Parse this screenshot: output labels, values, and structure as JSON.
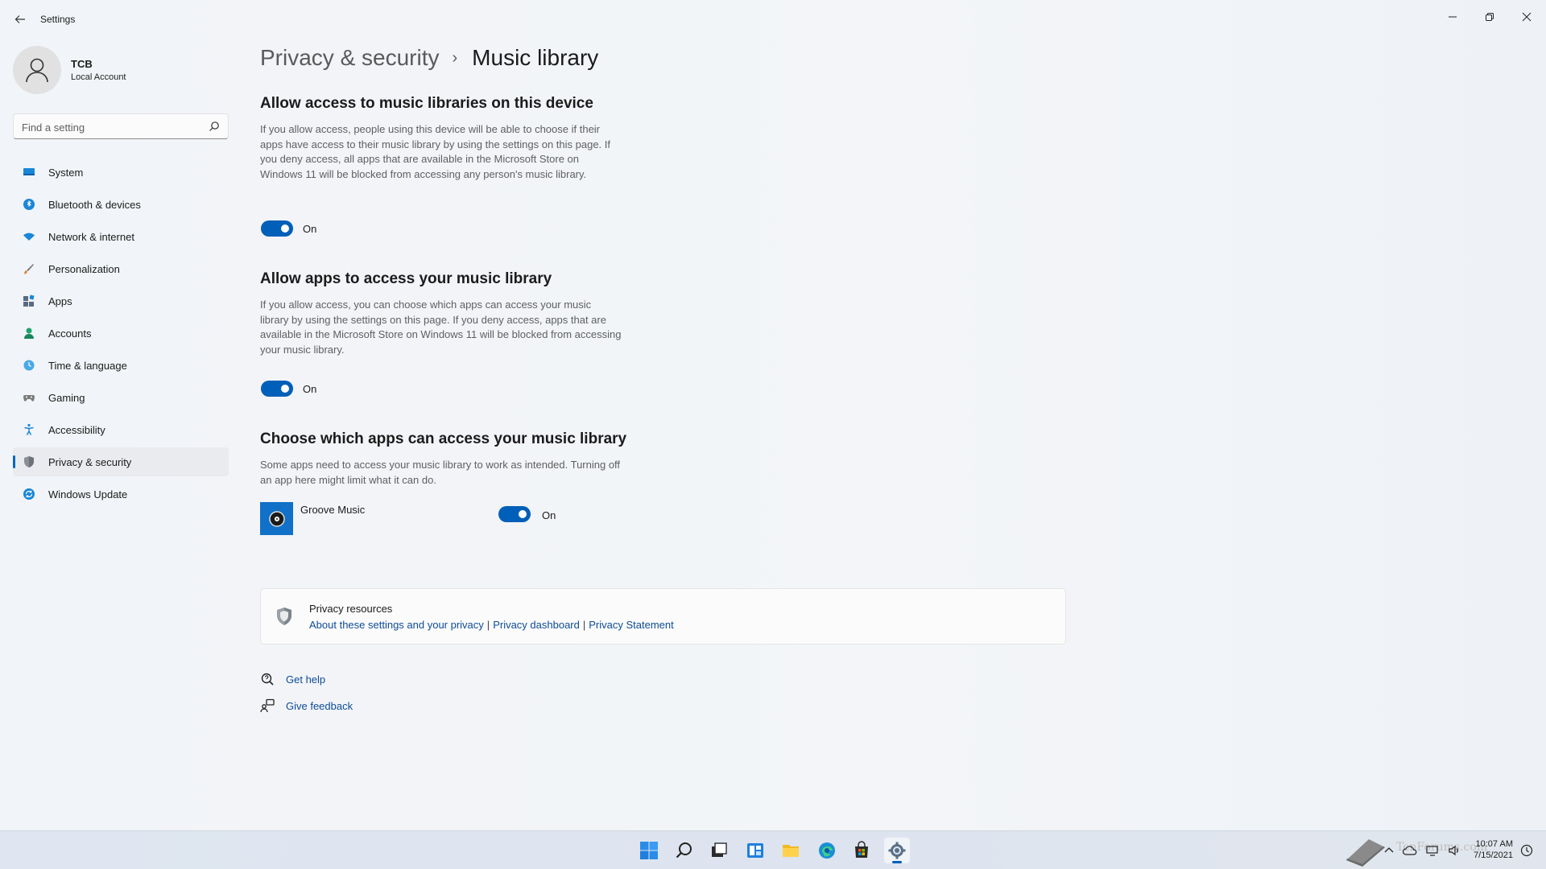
{
  "window": {
    "title": "Settings"
  },
  "profile": {
    "name": "TCB",
    "account_type": "Local Account"
  },
  "search": {
    "placeholder": "Find a setting"
  },
  "sidebar": {
    "items": [
      {
        "label": "System",
        "icon": "system-icon",
        "color": "#0078d4"
      },
      {
        "label": "Bluetooth & devices",
        "icon": "bluetooth-icon",
        "color": "#0078d4"
      },
      {
        "label": "Network & internet",
        "icon": "wifi-icon",
        "color": "#0078d4"
      },
      {
        "label": "Personalization",
        "icon": "brush-icon",
        "color": "#c46a2b"
      },
      {
        "label": "Apps",
        "icon": "apps-icon",
        "color": "#4a6a8a"
      },
      {
        "label": "Accounts",
        "icon": "accounts-icon",
        "color": "#1fa36a"
      },
      {
        "label": "Time & language",
        "icon": "globe-clock-icon",
        "color": "#0078d4"
      },
      {
        "label": "Gaming",
        "icon": "gamepad-icon",
        "color": "#6b6b6b"
      },
      {
        "label": "Accessibility",
        "icon": "accessibility-icon",
        "color": "#0078d4"
      },
      {
        "label": "Privacy & security",
        "icon": "shield-icon",
        "color": "#6b6b6b",
        "active": true
      },
      {
        "label": "Windows Update",
        "icon": "update-icon",
        "color": "#0078d4"
      }
    ]
  },
  "breadcrumb": {
    "parent": "Privacy & security",
    "separator": "›",
    "current": "Music library"
  },
  "sections": {
    "device_access": {
      "title": "Allow access to music libraries on this device",
      "description": "If you allow access, people using this device will be able to choose if their apps have access to their music library by using the settings on this page. If you deny access, all apps that are available in the Microsoft Store on Windows 11 will be blocked from accessing any person's music library.",
      "toggle_state": "On"
    },
    "apps_access": {
      "title": "Allow apps to access your music library",
      "description": "If you allow access, you can choose which apps can access your music library by using the settings on this page. If you deny access, apps that are available in the Microsoft Store on Windows 11 will be blocked from accessing your music library.",
      "toggle_state": "On"
    },
    "choose_apps": {
      "title": "Choose which apps can access your music library",
      "description": "Some apps need to access your music library to work as intended. Turning off an app here might limit what it can do.",
      "apps": [
        {
          "name": "Groove Music",
          "toggle_state": "On"
        }
      ]
    }
  },
  "privacy_resources": {
    "title": "Privacy resources",
    "links": [
      "About these settings and your privacy",
      "Privacy dashboard",
      "Privacy Statement"
    ],
    "separator": "|"
  },
  "help": {
    "get_help": "Get help",
    "give_feedback": "Give feedback"
  },
  "taskbar": {
    "apps": [
      "start-icon",
      "search-icon",
      "task-view-icon",
      "widgets-icon",
      "file-explorer-icon",
      "edge-icon",
      "store-icon",
      "settings-icon"
    ],
    "clock_time": "10:07 AM",
    "clock_date": "7/15/2021",
    "watermark": "TenForums.com"
  },
  "colors": {
    "accent": "#005fb8",
    "link": "#0e4c96"
  }
}
